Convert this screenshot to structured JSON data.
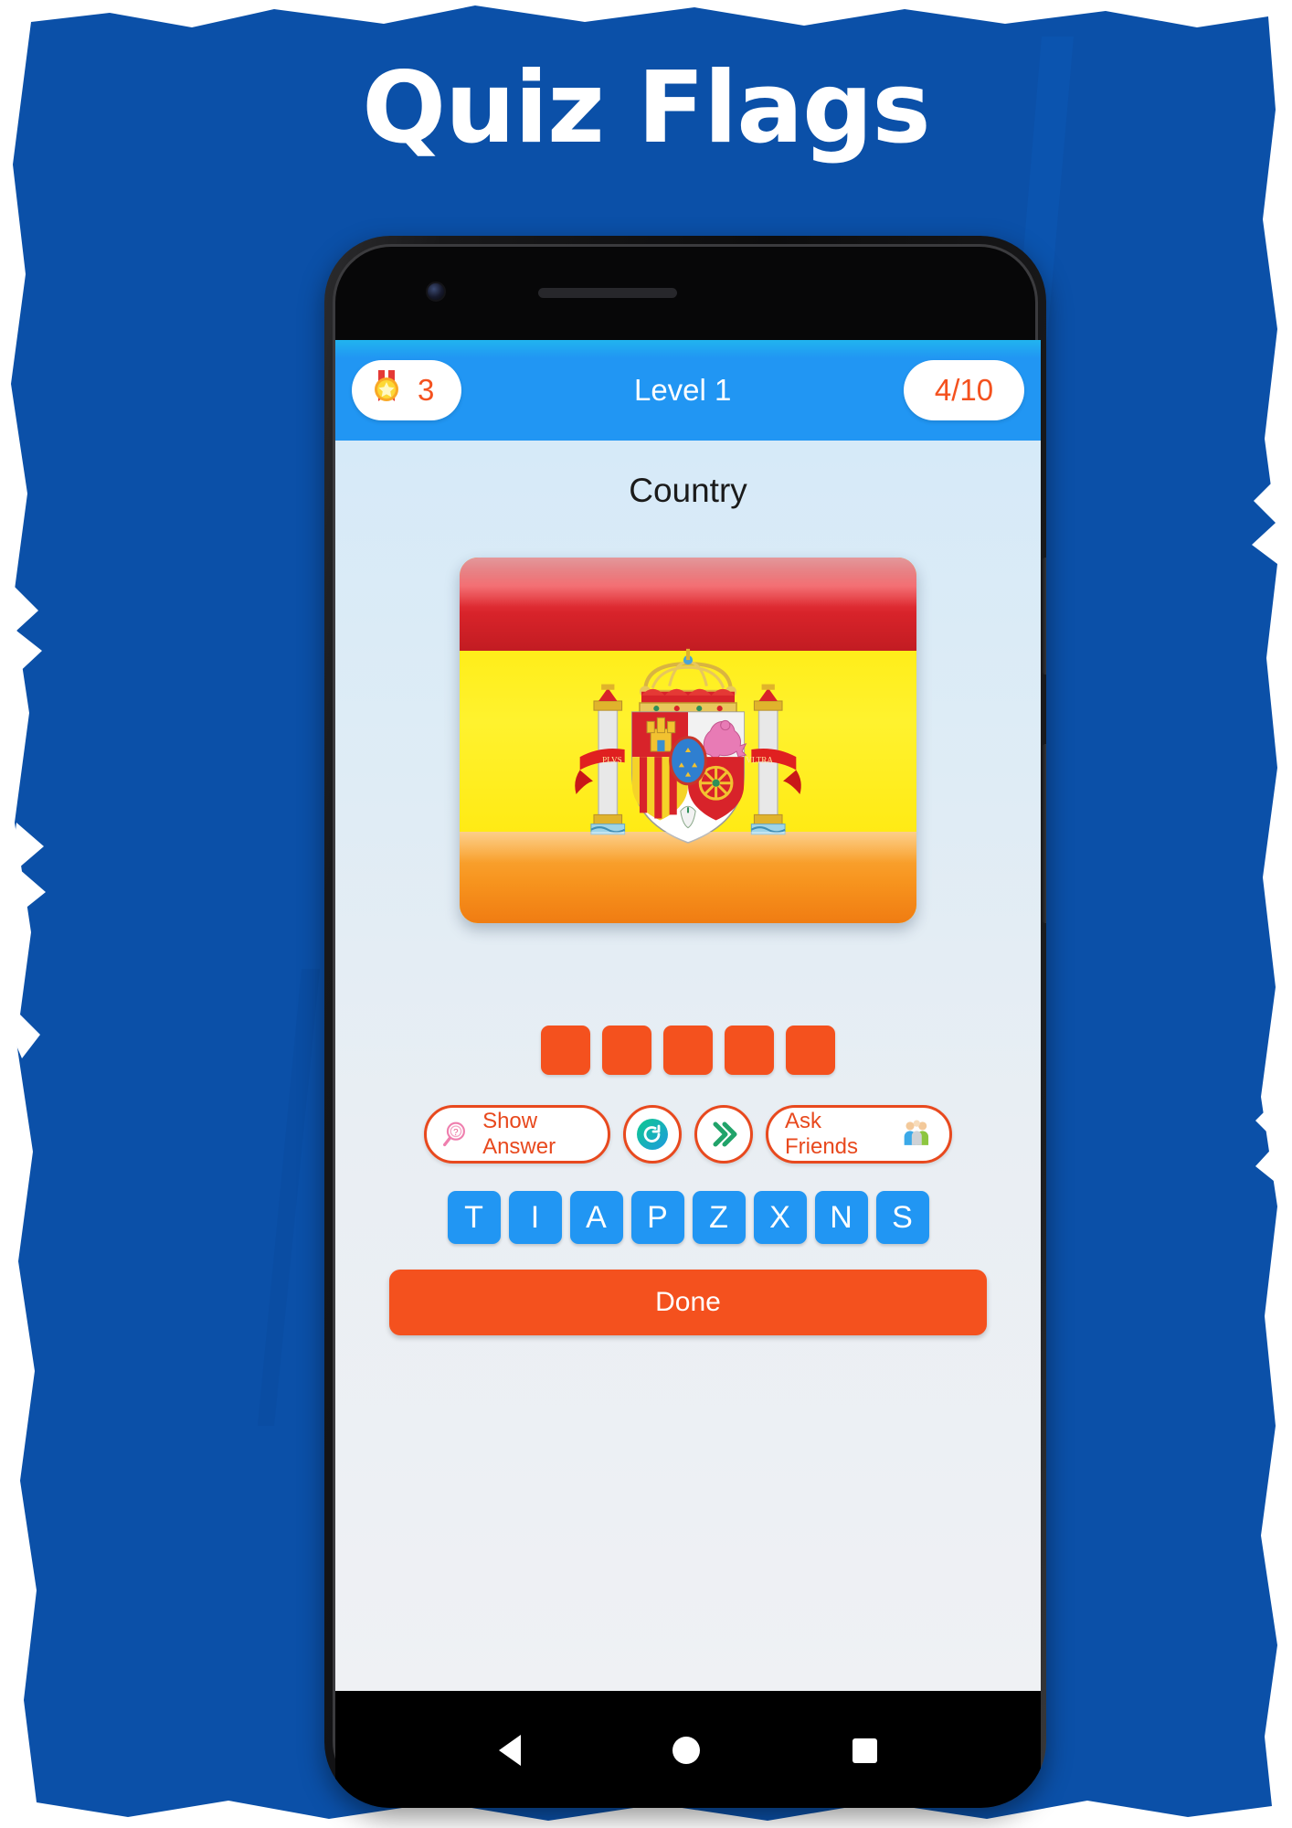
{
  "title": "Quiz Flags",
  "colors": {
    "background_blue": "#0b50a8",
    "header_blue": "#2196f3",
    "accent_orange": "#f4511e",
    "tile_blue": "#2196f3",
    "screen_bg": "#e3eef7"
  },
  "phone": {
    "camera_icon": "camera-icon",
    "speaker_icon": "speaker-grill-icon",
    "power_button": "power-button",
    "volume_button": "volume-button"
  },
  "app": {
    "header": {
      "score_icon": "medal-star-icon",
      "score_value": "3",
      "level_label": "Level 1",
      "progress_value": "4/10"
    },
    "category_label": "Country",
    "flag": {
      "icon": "spain-flag-icon",
      "alt": "Spain",
      "stripes": [
        "#d8232a",
        "#ffe800",
        "#f7941e"
      ]
    },
    "answer_slots": [
      "",
      "",
      "",
      "",
      ""
    ],
    "helpers": [
      {
        "name": "show-answer",
        "label": "Show Answer",
        "icon": "magnifier-question-icon"
      },
      {
        "name": "refresh",
        "label": "",
        "icon": "refresh-circle-icon"
      },
      {
        "name": "skip",
        "label": "",
        "icon": "double-chevron-right-icon"
      },
      {
        "name": "ask-friends",
        "label": "Ask Friends",
        "icon": "people-group-icon"
      }
    ],
    "letters": [
      "T",
      "I",
      "A",
      "P",
      "Z",
      "X",
      "N",
      "S"
    ],
    "done_label": "Done"
  },
  "nav": {
    "back": "back-icon",
    "home": "home-icon",
    "recents": "recents-icon"
  }
}
